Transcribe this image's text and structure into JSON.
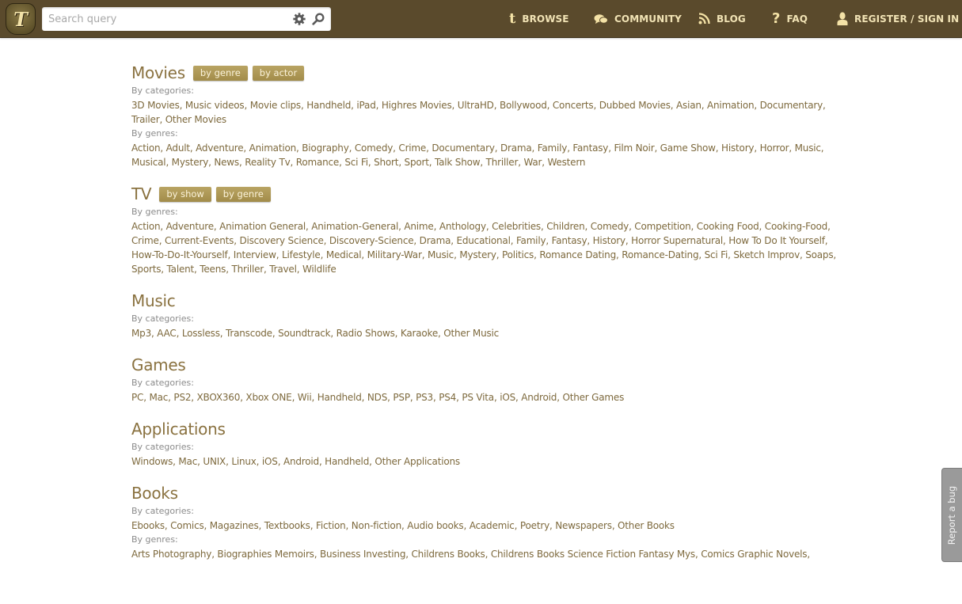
{
  "header": {
    "logo_letter": "T",
    "search": {
      "placeholder": "Search query",
      "value": ""
    },
    "nav": [
      {
        "icon": "tumblr-icon",
        "label": "BROWSE"
      },
      {
        "icon": "chat-bubbles-icon",
        "label": "COMMUNITY"
      },
      {
        "icon": "rss-icon",
        "label": "BLOG"
      },
      {
        "icon": "question-icon",
        "label": "FAQ"
      },
      {
        "icon": "user-icon",
        "label": "REGISTER / SIGN IN"
      }
    ]
  },
  "sections": [
    {
      "title": "Movies",
      "buttons": [
        "by genre",
        "by actor"
      ],
      "groups": [
        {
          "label": "By categories:",
          "items": [
            "3D Movies",
            "Music videos",
            "Movie clips",
            "Handheld",
            "iPad",
            "Highres Movies",
            "UltraHD",
            "Bollywood",
            "Concerts",
            "Dubbed Movies",
            "Asian",
            "Animation",
            "Documentary",
            "Trailer",
            "Other Movies"
          ]
        },
        {
          "label": "By genres:",
          "items": [
            "Action",
            "Adult",
            "Adventure",
            "Animation",
            "Biography",
            "Comedy",
            "Crime",
            "Documentary",
            "Drama",
            "Family",
            "Fantasy",
            "Film Noir",
            "Game Show",
            "History",
            "Horror",
            "Music",
            "Musical",
            "Mystery",
            "News",
            "Reality Tv",
            "Romance",
            "Sci Fi",
            "Short",
            "Sport",
            "Talk Show",
            "Thriller",
            "War",
            "Western"
          ]
        }
      ]
    },
    {
      "title": "TV",
      "buttons": [
        "by show",
        "by genre"
      ],
      "groups": [
        {
          "label": "By genres:",
          "items": [
            "Action",
            "Adventure",
            "Animation General",
            "Animation-General",
            "Anime",
            "Anthology",
            "Celebrities",
            "Children",
            "Comedy",
            "Competition",
            "Cooking Food",
            "Cooking-Food",
            "Crime",
            "Current-Events",
            "Discovery Science",
            "Discovery-Science",
            "Drama",
            "Educational",
            "Family",
            "Fantasy",
            "History",
            "Horror Supernatural",
            "How To Do It Yourself",
            "How-To-Do-It-Yourself",
            "Interview",
            "Lifestyle",
            "Medical",
            "Military-War",
            "Music",
            "Mystery",
            "Politics",
            "Romance Dating",
            "Romance-Dating",
            "Sci Fi",
            "Sketch Improv",
            "Soaps",
            "Sports",
            "Talent",
            "Teens",
            "Thriller",
            "Travel",
            "Wildlife"
          ]
        }
      ]
    },
    {
      "title": "Music",
      "buttons": [],
      "groups": [
        {
          "label": "By categories:",
          "items": [
            "Mp3",
            "AAC",
            "Lossless",
            "Transcode",
            "Soundtrack",
            "Radio Shows",
            "Karaoke",
            "Other Music"
          ]
        }
      ]
    },
    {
      "title": "Games",
      "buttons": [],
      "groups": [
        {
          "label": "By categories:",
          "items": [
            "PC",
            "Mac",
            "PS2",
            "XBOX360",
            "Xbox ONE",
            "Wii",
            "Handheld",
            "NDS",
            "PSP",
            "PS3",
            "PS4",
            "PS Vita",
            "iOS",
            "Android",
            "Other Games"
          ]
        }
      ]
    },
    {
      "title": "Applications",
      "buttons": [],
      "groups": [
        {
          "label": "By categories:",
          "items": [
            "Windows",
            "Mac",
            "UNIX",
            "Linux",
            "iOS",
            "Android",
            "Handheld",
            "Other Applications"
          ]
        }
      ]
    },
    {
      "title": "Books",
      "buttons": [],
      "groups": [
        {
          "label": "By categories:",
          "items": [
            "Ebooks",
            "Comics",
            "Magazines",
            "Textbooks",
            "Fiction",
            "Non-fiction",
            "Audio books",
            "Academic",
            "Poetry",
            "Newspapers",
            "Other Books"
          ]
        },
        {
          "label": "By genres:",
          "items": [
            "Arts Photography",
            "Biographies Memoirs",
            "Business Investing",
            "Childrens Books",
            "Childrens Books Science Fiction Fantasy Mys",
            "Comics Graphic Novels"
          ],
          "trailing_comma": true
        }
      ]
    }
  ],
  "report_bug": {
    "label": "Report a bug"
  }
}
